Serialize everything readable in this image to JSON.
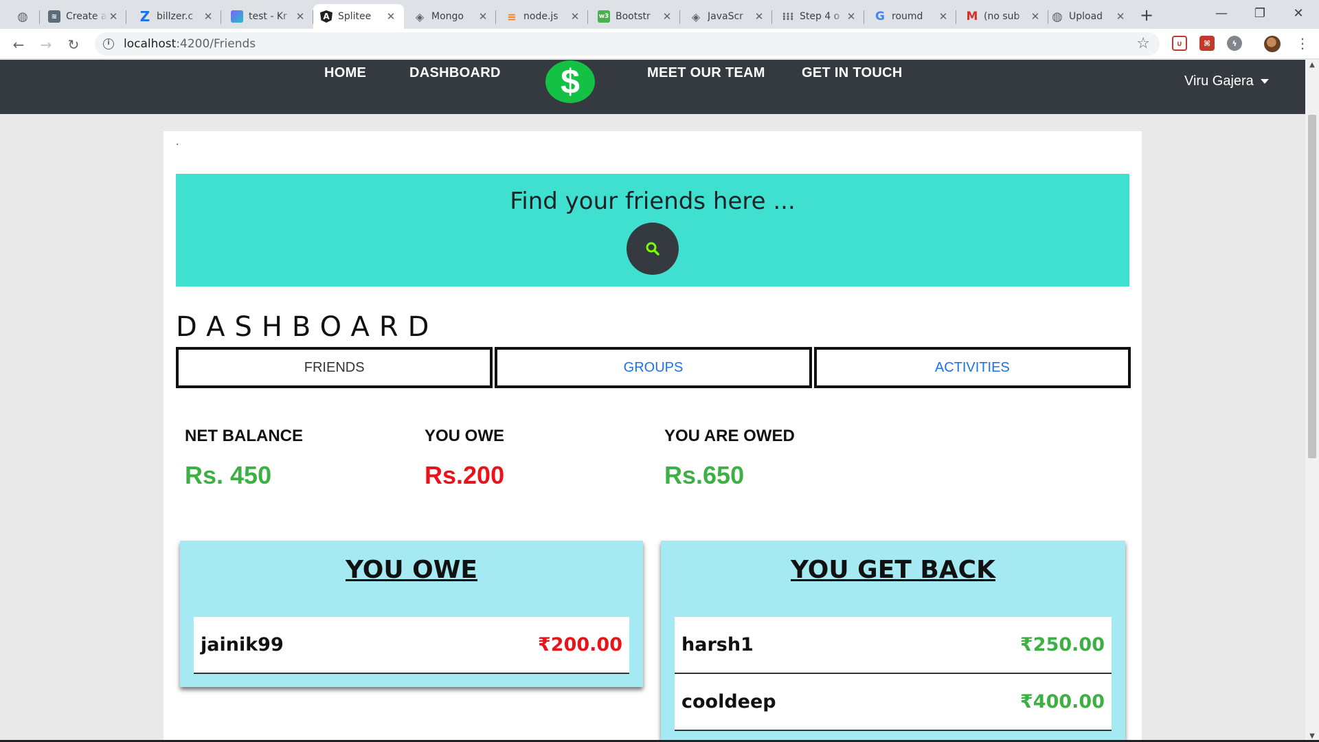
{
  "browser": {
    "tabs": [
      {
        "title": "",
        "icon": "globe-icon",
        "active": false
      },
      {
        "title": "Create a",
        "icon": "layers-icon",
        "active": false
      },
      {
        "title": "billzer.c",
        "icon": "z-letter-icon",
        "active": false
      },
      {
        "title": "test - Kr",
        "icon": "kristal-icon",
        "active": false
      },
      {
        "title": "Splitee",
        "icon": "angular-icon",
        "active": true
      },
      {
        "title": "Mongo",
        "icon": "diamond-icon",
        "active": false
      },
      {
        "title": "node.js",
        "icon": "stackoverflow-icon",
        "active": false
      },
      {
        "title": "Bootstr",
        "icon": "w3schools-icon",
        "active": false
      },
      {
        "title": "JavaScr",
        "icon": "diamond-icon",
        "active": false
      },
      {
        "title": "Step 4 o",
        "icon": "grid-icon",
        "active": false
      },
      {
        "title": "roumd",
        "icon": "google-icon",
        "active": false
      },
      {
        "title": "(no sub",
        "icon": "gmail-icon",
        "active": false
      },
      {
        "title": "Upload",
        "icon": "globe-icon",
        "active": false
      }
    ],
    "url_host": "localhost",
    "url_rest": ":4200/Friends"
  },
  "nav": {
    "home": "HOME",
    "dashboard": "DASHBOARD",
    "logo_symbol": "$",
    "team": "MEET OUR TEAM",
    "contact": "GET IN TOUCH",
    "user": "Viru Gajera"
  },
  "page": {
    "dot": ".",
    "hero_title": "Find your friends here ...",
    "dashboard_title": "DASHBOARD",
    "tabs": [
      "FRIENDS",
      "GROUPS",
      "ACTIVITIES"
    ]
  },
  "balances": {
    "net_label": "NET BALANCE",
    "net_value": "Rs. 450",
    "owe_label": "YOU OWE",
    "owe_value": "Rs.200",
    "owed_label": "YOU ARE OWED",
    "owed_value": "Rs.650"
  },
  "you_owe": {
    "title": "YOU OWE",
    "rows": [
      {
        "name": "jainik99",
        "amount": "₹200.00"
      }
    ]
  },
  "you_get_back": {
    "title": "YOU GET BACK",
    "rows": [
      {
        "name": "harsh1",
        "amount": "₹250.00"
      },
      {
        "name": "cooldeep",
        "amount": "₹400.00"
      }
    ]
  },
  "colors": {
    "navbar": "#343a40",
    "hero": "#40e0d0",
    "panel": "#a5eaf2",
    "positive": "#3cb043",
    "negative": "#e8141a",
    "logo": "#14c145"
  }
}
